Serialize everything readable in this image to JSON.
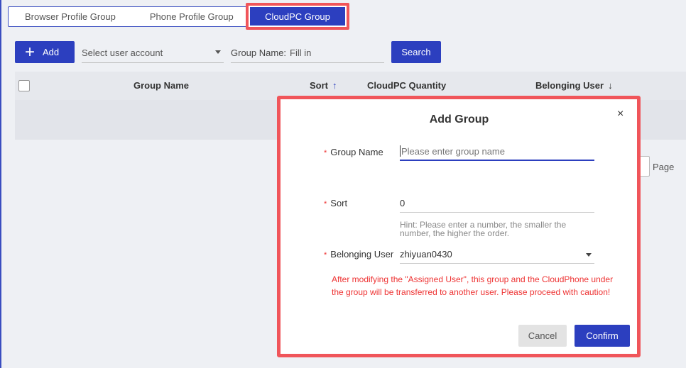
{
  "tabs": [
    {
      "label": "Browser Profile Group"
    },
    {
      "label": "Phone Profile Group"
    },
    {
      "label": "CloudPC Group"
    }
  ],
  "toolbar": {
    "add_label": "Add",
    "user_select_placeholder": "Select user account",
    "group_name_label": "Group Name:",
    "group_name_placeholder": "Fill in",
    "search_label": "Search"
  },
  "table": {
    "columns": [
      "Group Name",
      "Sort",
      "CloudPC Quantity",
      "Belonging User"
    ]
  },
  "pagination": {
    "page_label": "Page"
  },
  "modal": {
    "title": "Add Group",
    "close": "×",
    "group_name_label": "Group Name",
    "group_name_placeholder": "Please enter group name",
    "sort_label": "Sort",
    "sort_value": "0",
    "sort_hint": "Hint: Please enter a number, the smaller the number, the higher the order.",
    "owner_label": "Belonging User",
    "owner_value": "zhiyuan0430",
    "warning": "After modifying the \"Assigned User\", this group and the CloudPhone under the group will be transferred to another user. Please proceed with caution!",
    "cancel_label": "Cancel",
    "confirm_label": "Confirm",
    "required_mark": "*"
  },
  "colors": {
    "primary": "#2c3fbf",
    "highlight": "#f0555a",
    "warning": "#e33333"
  }
}
